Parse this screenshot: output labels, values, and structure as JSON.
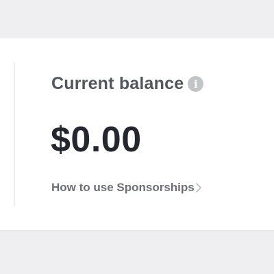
{
  "balance_card": {
    "label": "Current balance",
    "info_icon": "info-icon",
    "amount": "$0.00",
    "help_link_label": "How to use Sponsorships",
    "chevron_icon": "chevron-right-icon"
  },
  "colors": {
    "page_background": "#efeff1",
    "card_background": "#ffffff",
    "label_text": "#52565e",
    "amount_text": "#24272e",
    "link_text": "#6a6e76",
    "info_icon_bg": "#c3c4c8"
  }
}
